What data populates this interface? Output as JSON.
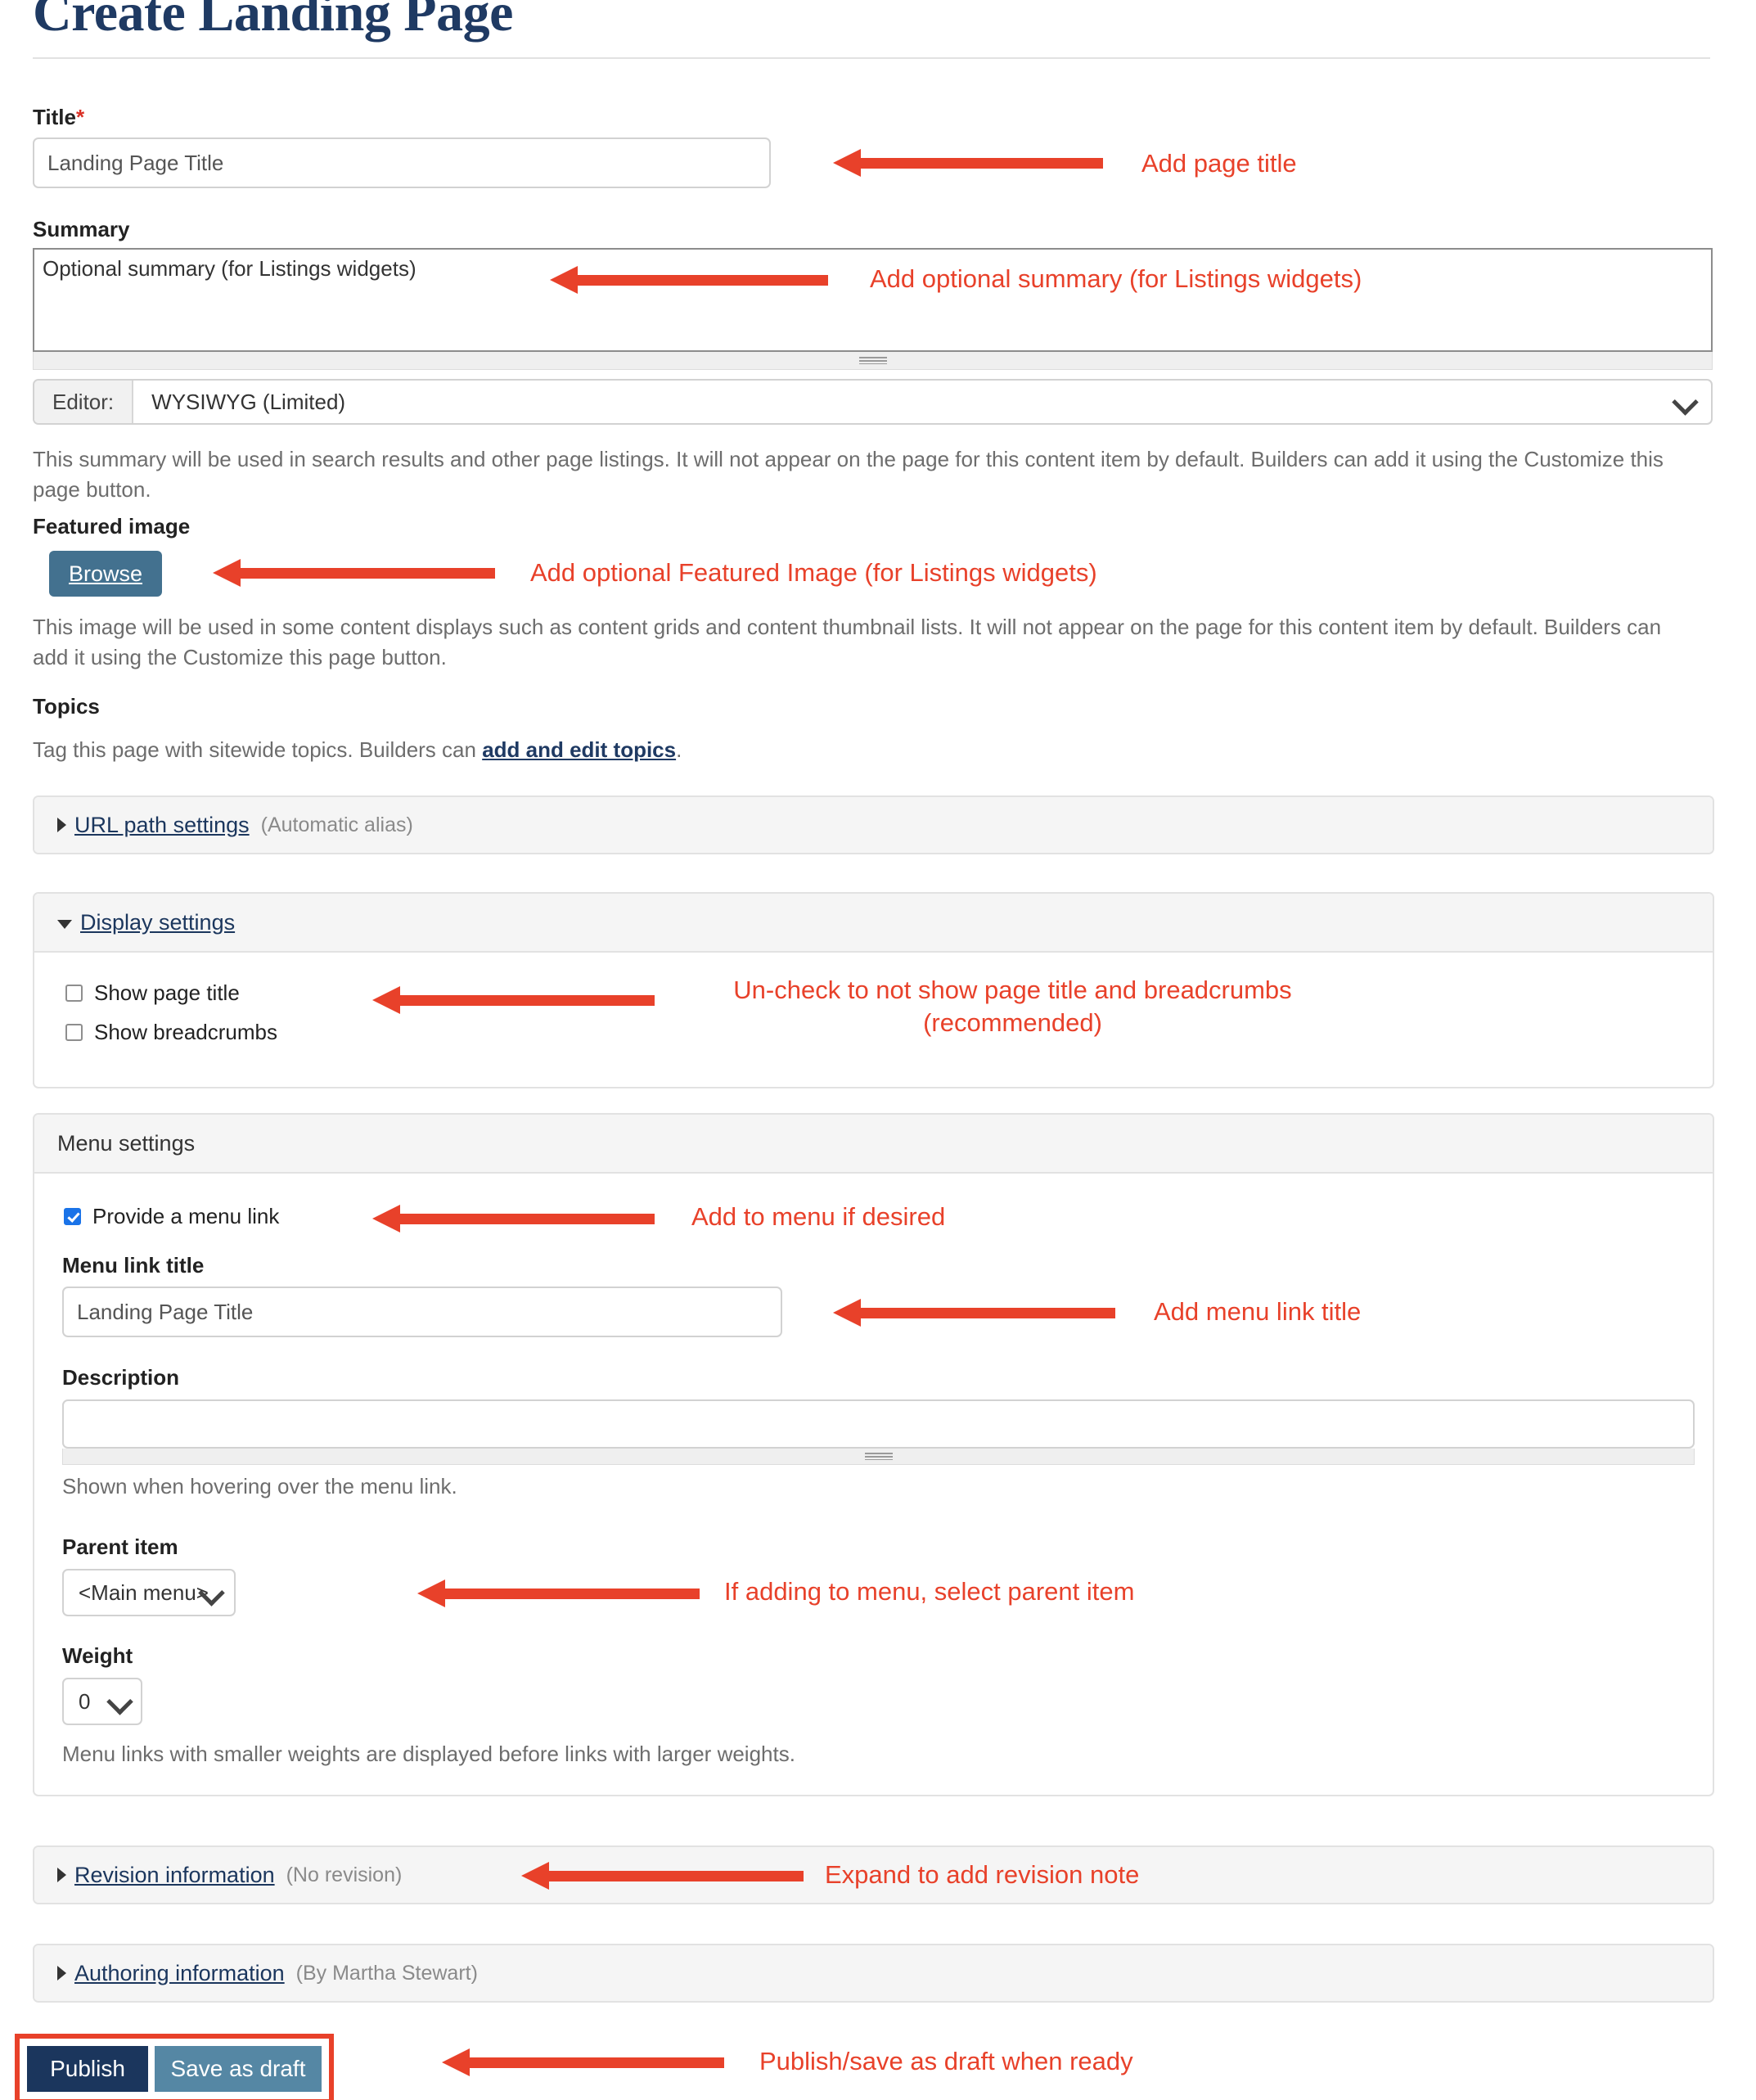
{
  "page": {
    "title": "Create Landing Page"
  },
  "fields": {
    "title": {
      "label": "Title",
      "required_marker": "*",
      "value": "Landing Page Title"
    },
    "summary": {
      "label": "Summary",
      "value": "Optional summary (for Listings widgets)",
      "editor_prefix": "Editor:",
      "editor_value": "WYSIWYG (Limited)",
      "help": "This summary will be used in search results and other page listings. It will not appear on the page for this content item by default. Builders can add it using the Customize this page button."
    },
    "featured_image": {
      "label": "Featured image",
      "browse_label": "Browse",
      "help": "This image will be used in some content displays such as content grids and content thumbnail lists. It will not appear on the page for this content item by default. Builders can add it using the Customize this page button."
    },
    "topics": {
      "label": "Topics",
      "help_prefix": "Tag this page with sitewide topics. Builders can ",
      "help_link": "add and edit topics",
      "help_suffix": "."
    }
  },
  "sections": {
    "url_path": {
      "title": "URL path settings",
      "summary": "(Automatic alias)",
      "expanded": false
    },
    "display": {
      "title": "Display settings",
      "expanded": true,
      "checkboxes": [
        {
          "label": "Show page title",
          "checked": false
        },
        {
          "label": "Show breadcrumbs",
          "checked": false
        }
      ]
    },
    "menu": {
      "title": "Menu settings",
      "provide_link": {
        "label": "Provide a menu link",
        "checked": true
      },
      "menu_link_title": {
        "label": "Menu link title",
        "value": "Landing Page Title"
      },
      "description": {
        "label": "Description",
        "value": "",
        "help": "Shown when hovering over the menu link."
      },
      "parent_item": {
        "label": "Parent item",
        "value": "<Main menu>"
      },
      "weight": {
        "label": "Weight",
        "value": "0",
        "help": "Menu links with smaller weights are displayed before links with larger weights."
      }
    },
    "revision": {
      "title": "Revision information",
      "summary": "(No revision)",
      "expanded": false
    },
    "authoring": {
      "title": "Authoring information",
      "summary": "(By Martha Stewart)",
      "expanded": false
    }
  },
  "actions": {
    "publish": "Publish",
    "save_draft": "Save as draft"
  },
  "annotations": {
    "a1": "Add page title",
    "a2": "Add optional summary (for Listings widgets)",
    "a3": "Add optional Featured Image (for Listings widgets)",
    "a4_line1": "Un-check to not show page title and breadcrumbs",
    "a4_line2": "(recommended)",
    "a5": "Add to menu if desired",
    "a6": "Add menu link title",
    "a7": "If adding to menu, select parent item",
    "a8": "Expand to add revision note",
    "a9": "Publish/save as draft when ready"
  },
  "colors": {
    "annotation": "#E8412A",
    "title": "#1F3A63",
    "publish": "#1B365D",
    "save_draft": "#5587A4",
    "browse": "#43718F",
    "checkbox_checked": "#1a73e8"
  }
}
